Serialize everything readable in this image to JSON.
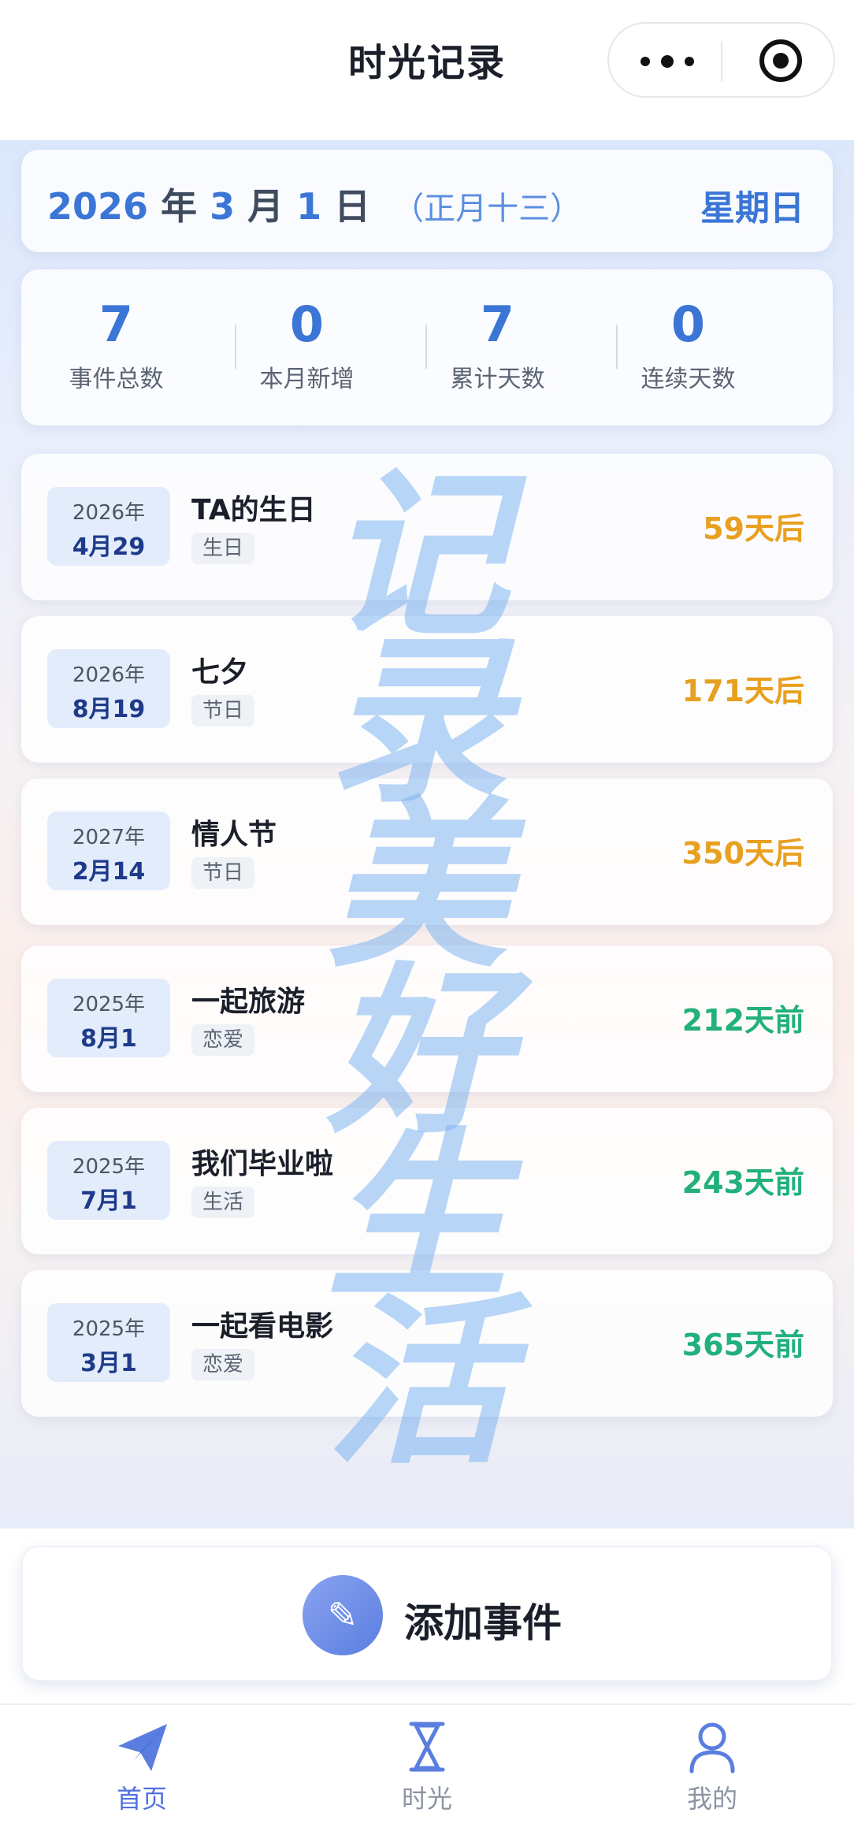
{
  "header": {
    "title": "时光记录"
  },
  "date_card": {
    "year": "2026",
    "year_unit": "年",
    "month": "3",
    "month_unit": "月",
    "day": "1",
    "day_unit": "日",
    "lunar": "（正月十三）",
    "weekday": "星期日"
  },
  "stats": [
    {
      "value": "7",
      "label": "事件总数"
    },
    {
      "value": "0",
      "label": "本月新增"
    },
    {
      "value": "7",
      "label": "累计天数"
    },
    {
      "value": "0",
      "label": "连续天数"
    }
  ],
  "watermark": [
    "记",
    "录",
    "美",
    "好",
    "生",
    "活"
  ],
  "events": [
    {
      "year": "2026年",
      "md": "4月29",
      "name": "TA的生日",
      "tag": "生日",
      "days": "59天后",
      "status": "future"
    },
    {
      "year": "2026年",
      "md": "8月19",
      "name": "七夕",
      "tag": "节日",
      "days": "171天后",
      "status": "future"
    },
    {
      "year": "2027年",
      "md": "2月14",
      "name": "情人节",
      "tag": "节日",
      "days": "350天后",
      "status": "future"
    },
    {
      "year": "2025年",
      "md": "8月1",
      "name": "一起旅游",
      "tag": "恋爱",
      "days": "212天前",
      "status": "past"
    },
    {
      "year": "2025年",
      "md": "7月1",
      "name": "我们毕业啦",
      "tag": "生活",
      "days": "243天前",
      "status": "past"
    },
    {
      "year": "2025年",
      "md": "3月1",
      "name": "一起看电影",
      "tag": "恋爱",
      "days": "365天前",
      "status": "past"
    }
  ],
  "add_button": {
    "icon": "memo-pencil-icon",
    "label": "添加事件"
  },
  "tabs": [
    {
      "label": "首页",
      "icon": "paper-plane-icon",
      "active": true
    },
    {
      "label": "时光",
      "icon": "hourglass-icon",
      "active": false
    },
    {
      "label": "我的",
      "icon": "user-icon",
      "active": false
    }
  ],
  "colors": {
    "accent": "#3b76d6",
    "future": "#e8a020",
    "past": "#22b07d",
    "tab_active": "#4f6fe0"
  }
}
